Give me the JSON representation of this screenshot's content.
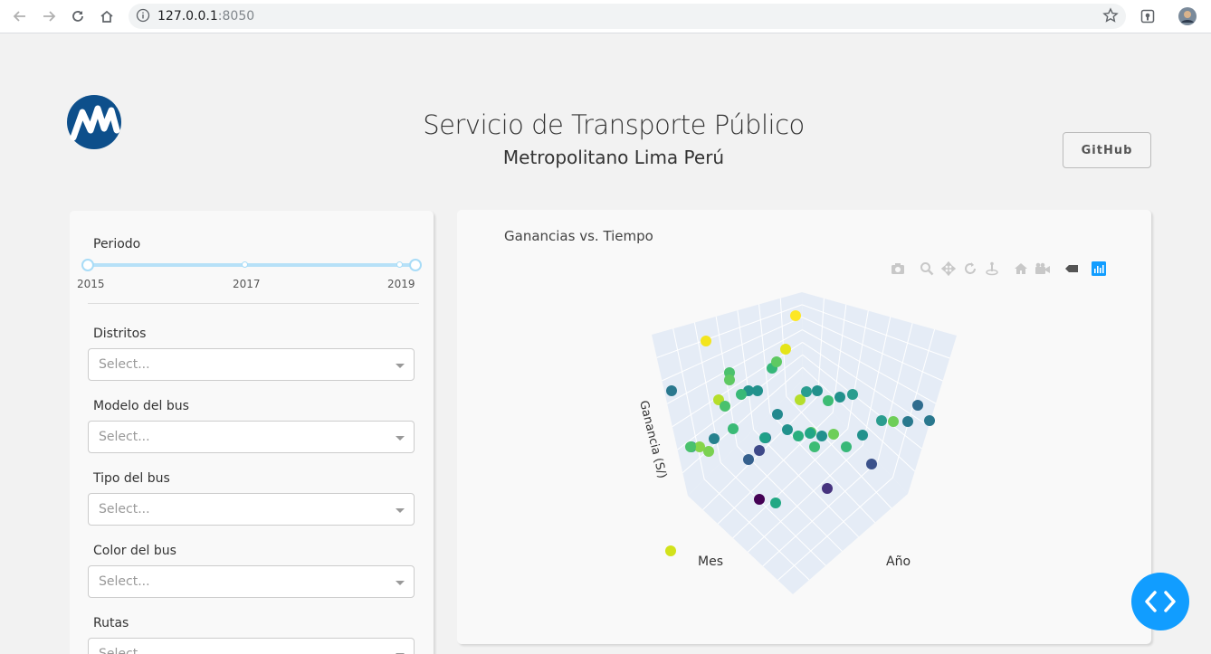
{
  "browser": {
    "url_host": "127.0.0.1",
    "url_port": ":8050"
  },
  "header": {
    "title": "Servicio de Transporte Público",
    "subtitle": "Metropolitano Lima Perú",
    "github_label": "GitHub"
  },
  "filters": {
    "period_label": "Periodo",
    "period_ticks": [
      "2015",
      "2017",
      "2019"
    ],
    "period_range": [
      2015,
      2019
    ],
    "districts_label": "Distritos",
    "bus_model_label": "Modelo del bus",
    "bus_type_label": "Tipo del bus",
    "bus_color_label": "Color del bus",
    "routes_label": "Rutas",
    "select_placeholder": "Select..."
  },
  "chart": {
    "title": "Ganancias vs. Tiempo",
    "axis_x": "Mes",
    "axis_y": "Año",
    "axis_z": "Ganancia (S/)",
    "modebar_icons": [
      "camera-icon",
      "zoom-icon",
      "pan-icon",
      "orbit-icon",
      "turntable-icon",
      "home-icon",
      "camera-view-icon",
      "hover-icon",
      "plotly-logo-icon"
    ]
  },
  "chart_data": {
    "type": "scatter",
    "title": "Ganancias vs. Tiempo",
    "xlabel": "Mes",
    "ylabel": "Año",
    "zlabel": "Ganancia (S/)",
    "colorscale": "viridis",
    "points": [
      {
        "c": "#fde725"
      },
      {
        "c": "#d2e21b"
      },
      {
        "c": "#f3e51e"
      },
      {
        "c": "#e5e419"
      },
      {
        "c": "#35b779"
      },
      {
        "c": "#5ec962"
      },
      {
        "c": "#2a788e"
      },
      {
        "c": "#4ac16d"
      },
      {
        "c": "#21918c"
      },
      {
        "c": "#21918c"
      },
      {
        "c": "#38b977"
      },
      {
        "c": "#b5de2b"
      },
      {
        "c": "#5ec962"
      },
      {
        "c": "#b5de2b"
      },
      {
        "c": "#2a9d8f"
      },
      {
        "c": "#21918c"
      },
      {
        "c": "#3dbc74"
      },
      {
        "c": "#21918c"
      },
      {
        "c": "#2a9d8f"
      },
      {
        "c": "#4ac16d"
      },
      {
        "c": "#23898e"
      },
      {
        "c": "#2f6c8e"
      },
      {
        "c": "#2a9d8f"
      },
      {
        "c": "#6ece58"
      },
      {
        "c": "#29798e"
      },
      {
        "c": "#2a788e"
      },
      {
        "c": "#3aba76"
      },
      {
        "c": "#238a8d"
      },
      {
        "c": "#26828e"
      },
      {
        "c": "#21918c"
      },
      {
        "c": "#2a788e"
      },
      {
        "c": "#54c568"
      },
      {
        "c": "#29af7f"
      },
      {
        "c": "#21a685"
      },
      {
        "c": "#6ece58"
      },
      {
        "c": "#3dbc74"
      },
      {
        "c": "#21908d"
      },
      {
        "c": "#37b878"
      },
      {
        "c": "#1fa088"
      },
      {
        "c": "#7ad151"
      },
      {
        "c": "#3e4989"
      },
      {
        "c": "#35608d"
      },
      {
        "c": "#21918c"
      },
      {
        "c": "#86d549"
      },
      {
        "c": "#4ac16d"
      },
      {
        "c": "#3b528b"
      },
      {
        "c": "#440154"
      },
      {
        "c": "#22a884"
      },
      {
        "c": "#46337e"
      }
    ]
  }
}
